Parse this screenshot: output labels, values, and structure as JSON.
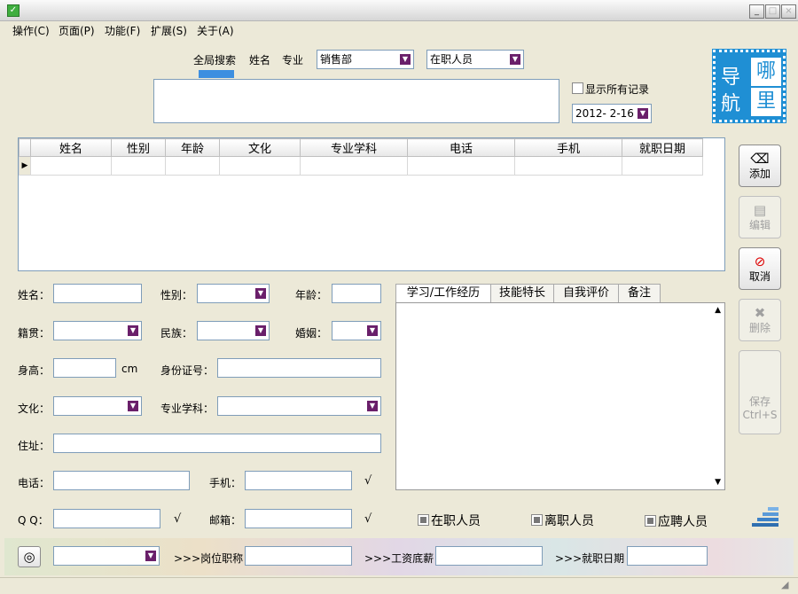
{
  "menu": [
    "操作(C)",
    "页面(P)",
    "功能(F)",
    "扩展(S)",
    "关于(A)"
  ],
  "search": {
    "tabs": [
      "全局搜索",
      "姓名",
      "专业"
    ],
    "department": "销售部",
    "status_filter": "在职人员",
    "show_all_label": "显示所有记录",
    "date": "2012- 2-16"
  },
  "logo": {
    "chars": [
      "导",
      "哪",
      "航",
      "里"
    ]
  },
  "grid": {
    "columns": [
      "姓名",
      "性别",
      "年龄",
      "文化",
      "专业学科",
      "电话",
      "手机",
      "就职日期"
    ]
  },
  "buttons": {
    "add": "添加",
    "edit": "编辑",
    "cancel": "取消",
    "delete": "删除",
    "save": "保存",
    "save_shortcut": "Ctrl+S"
  },
  "form": {
    "name": "姓名：",
    "gender": "性别：",
    "age": "年龄：",
    "native": "籍贯：",
    "ethnic": "民族：",
    "marriage": "婚姻：",
    "height": "身高：",
    "height_unit": "cm",
    "id_number": "身份证号：",
    "education": "文化：",
    "major": "专业学科：",
    "address": "住址：",
    "phone": "电话：",
    "mobile": "手机：",
    "qq": "Q Q：",
    "email": "邮箱：",
    "check": "√"
  },
  "detail_tabs": [
    "学习/工作经历",
    "技能特长",
    "自我评价",
    "备注"
  ],
  "status_options": [
    "在职人员",
    "离职人员",
    "应聘人员"
  ],
  "footer": {
    "position_label": ">>>岗位职称",
    "salary_label": ">>>工资底薪",
    "date_label": ">>>就职日期"
  }
}
